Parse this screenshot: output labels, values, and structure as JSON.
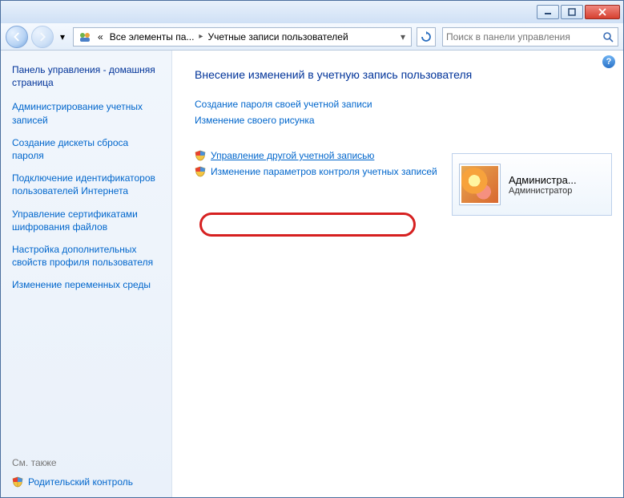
{
  "breadcrumb": {
    "crumb1_prefix": "«",
    "crumb1": "Все элементы па...",
    "crumb2": "Учетные записи пользователей"
  },
  "search": {
    "placeholder": "Поиск в панели управления"
  },
  "sidebar": {
    "title": "Панель управления - домашняя страница",
    "links": [
      "Администрирование учетных записей",
      "Создание дискеты сброса пароля",
      "Подключение идентификаторов пользователей Интернета",
      "Управление сертификатами шифрования файлов",
      "Настройка дополнительных свойств профиля пользователя",
      "Изменение переменных среды"
    ],
    "see_also": "См. также",
    "footer_link": "Родительский контроль"
  },
  "main": {
    "heading": "Внесение изменений в учетную запись пользователя",
    "links": {
      "create_password": "Создание пароля своей учетной записи",
      "change_picture": "Изменение своего рисунка",
      "manage_other": "Управление другой учетной записью",
      "uac_settings": "Изменение параметров контроля учетных записей"
    }
  },
  "account": {
    "name": "Администра...",
    "role": "Администратор"
  }
}
